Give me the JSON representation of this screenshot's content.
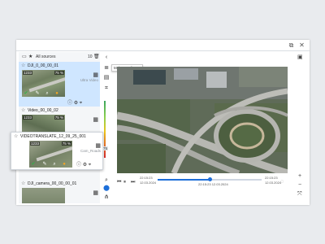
{
  "window": {
    "expand_icon": "⧉",
    "close_icon": "✕"
  },
  "sidebar": {
    "title": "All sources",
    "count": "10",
    "items": [
      {
        "title": "DJI_0_00_00_01",
        "frame": "1233",
        "percent": "75 %",
        "info": "Ultra Video"
      },
      {
        "title": "Video_00_00_02",
        "frame": "1233",
        "percent": "75 %",
        "info": ""
      },
      {
        "title": "VIDEOTRANSLATE_12_09_25_001",
        "frame": "1233",
        "percent": "75 %",
        "info": "Cam_Roads"
      },
      {
        "title": "DJI_camera_00_00_00_01",
        "frame": "",
        "percent": "",
        "info": ""
      }
    ]
  },
  "tooltip": "Make one frame",
  "colorbar_value": "75",
  "player": {
    "time_start": "22:15:23",
    "date_start": "12.03.2024",
    "time_current": "22:15:23",
    "date_current": "12.03.2024",
    "time_end": "22:15:23",
    "date_end": "12.03.2024",
    "progress": 0.5
  },
  "colors": {
    "accent": "#1e6fd9",
    "selection": "#cfe6ff"
  }
}
